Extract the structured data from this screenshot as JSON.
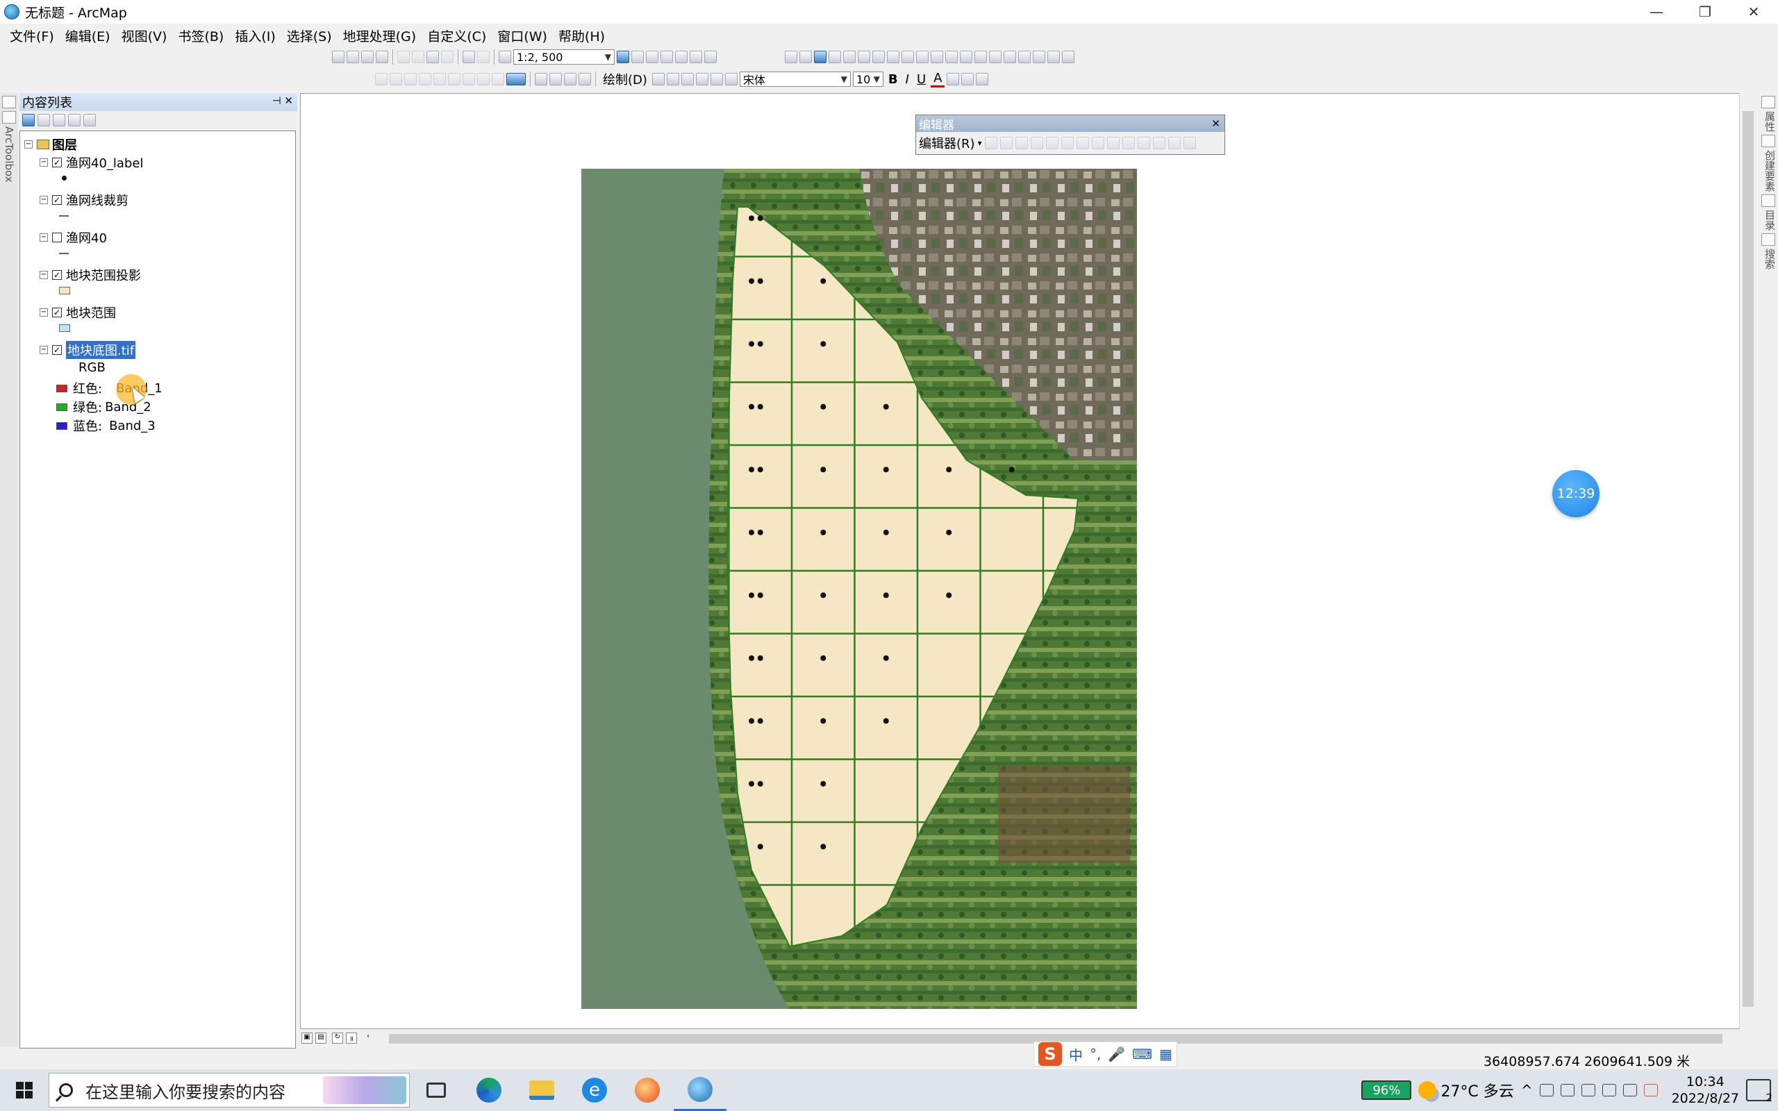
{
  "window": {
    "title": "无标题 - ArcMap",
    "min": "—",
    "restore": "❐",
    "close": "✕"
  },
  "menu": [
    "文件(F)",
    "编辑(E)",
    "视图(V)",
    "书签(B)",
    "插入(I)",
    "选择(S)",
    "地理处理(G)",
    "自定义(C)",
    "窗口(W)",
    "帮助(H)"
  ],
  "toolbar": {
    "scale": "1:2, 500",
    "draw_label": "绘制(D)",
    "font_name": "宋体",
    "font_size": "10",
    "bold": "B",
    "italic": "I",
    "underline": "U",
    "font_color": "A"
  },
  "leftrail": {
    "label": "ArcToolbox"
  },
  "toc": {
    "title": "内容列表",
    "root": "图层",
    "layers": [
      {
        "name": "渔网40_label",
        "checked": true,
        "symbol": "point",
        "color": "#111111"
      },
      {
        "name": "渔网线裁剪",
        "checked": true,
        "symbol": "line",
        "color": "#2e8b2e"
      },
      {
        "name": "渔网40",
        "checked": false,
        "symbol": "line",
        "color": "#2e8b2e"
      },
      {
        "name": "地块范围投影",
        "checked": true,
        "symbol": "fill",
        "color": "#f5e6c4"
      },
      {
        "name": "地块范围",
        "checked": true,
        "symbol": "fill",
        "color": "#bfe6f5"
      },
      {
        "name": "地块底图.tif",
        "checked": true,
        "symbol": "raster",
        "selected": true
      }
    ],
    "raster_legend": {
      "rgb": "RGB",
      "bands": [
        {
          "label": "红色:",
          "band": "Band_1",
          "color": "#d42020"
        },
        {
          "label": "绿色:",
          "band": "Band_2",
          "color": "#22b022"
        },
        {
          "label": "蓝色:",
          "band": "Band_3",
          "color": "#2020d4"
        }
      ]
    }
  },
  "editor": {
    "title": "编辑器",
    "menu": "编辑器(R)"
  },
  "rightrail": {
    "labels": [
      "属性",
      "创建要素",
      "目录",
      "搜索"
    ]
  },
  "timer": "12:39",
  "status": {
    "coordinates": "36408957.674  2609641.509 米"
  },
  "ime": {
    "logo": "S",
    "items": [
      "中",
      "°,",
      "🎤",
      "⌨",
      "▦"
    ]
  },
  "taskbar": {
    "search_placeholder": "在这里输入你要搜索的内容",
    "battery": "96%",
    "weather": "27°C  多云",
    "time": "10:34",
    "date": "2022/8/27",
    "notification_count": "2"
  },
  "map": {
    "fishnet_cols": 6,
    "fishnet_rows": 11,
    "parcel_fill": "#f5e6c4",
    "grid_color": "#2e7d22",
    "water_color": "#6b8a6e"
  }
}
